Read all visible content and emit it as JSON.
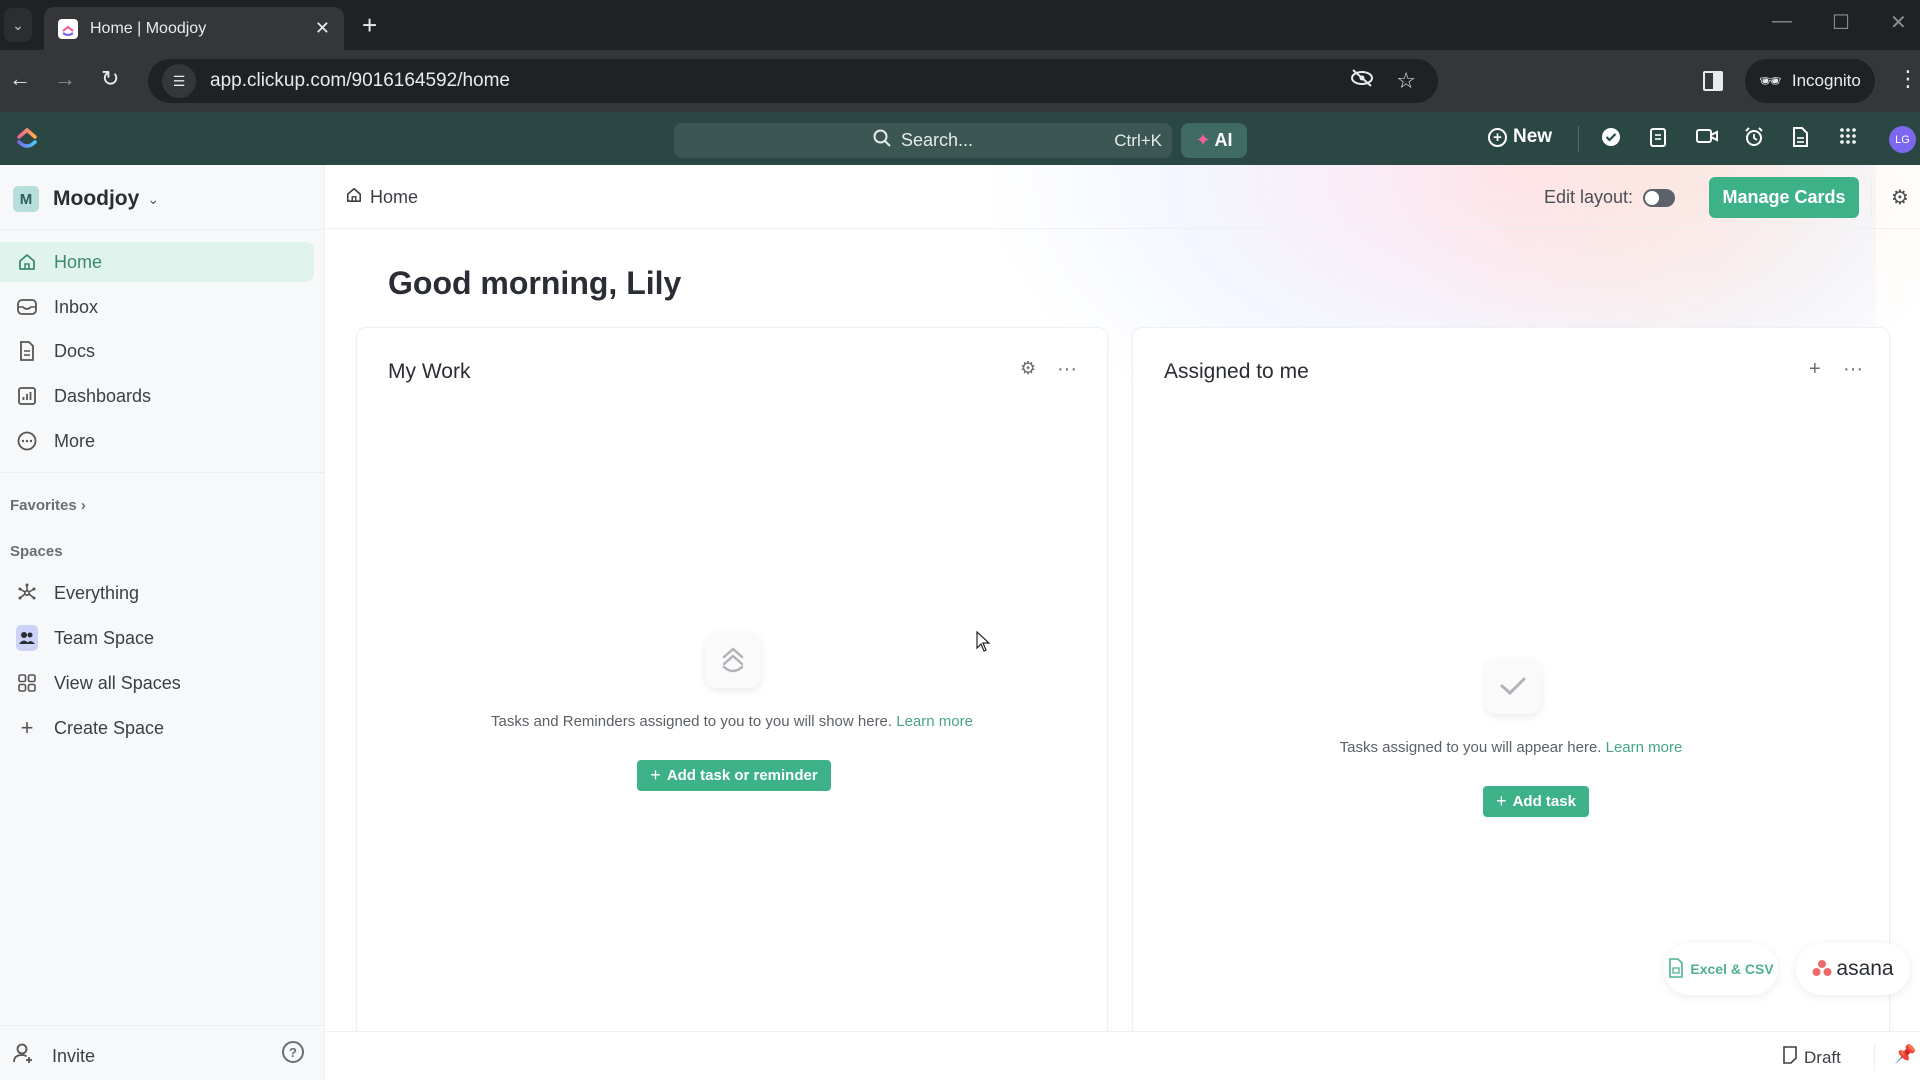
{
  "browser": {
    "tab_title": "Home | Moodjoy",
    "url": "app.clickup.com/9016164592/home",
    "incognito_label": "Incognito"
  },
  "appbar": {
    "search_placeholder": "Search...",
    "search_shortcut": "Ctrl+K",
    "ai_label": "AI",
    "new_label": "New",
    "avatar_initials": "LG",
    "icons": [
      "check-circle-icon",
      "notepad-icon",
      "video-icon",
      "alarm-clock-icon",
      "document-icon",
      "apps-grid-icon"
    ]
  },
  "sidebar": {
    "workspace_initial": "M",
    "workspace_name": "Moodjoy",
    "nav": [
      {
        "label": "Home",
        "icon": "home-icon",
        "active": true
      },
      {
        "label": "Inbox",
        "icon": "inbox-icon"
      },
      {
        "label": "Docs",
        "icon": "docs-icon"
      },
      {
        "label": "Dashboards",
        "icon": "dashboard-icon"
      },
      {
        "label": "More",
        "icon": "more-icon"
      }
    ],
    "favorites_label": "Favorites",
    "spaces_label": "Spaces",
    "spaces": [
      {
        "label": "Everything",
        "icon": "everything-icon"
      },
      {
        "label": "Team Space",
        "icon": "team-icon"
      },
      {
        "label": "View all Spaces",
        "icon": "grid-icon"
      },
      {
        "label": "Create Space",
        "icon": "plus-icon"
      }
    ],
    "invite_label": "Invite"
  },
  "main": {
    "breadcrumb": "Home",
    "edit_layout_label": "Edit layout:",
    "edit_layout_on": false,
    "manage_cards_label": "Manage Cards",
    "greeting": "Good morning, Lily",
    "cards": {
      "my_work": {
        "title": "My Work",
        "empty_text": "Tasks and Reminders assigned to you to you will show here.",
        "learn_more": "Learn more",
        "button": "Add task or reminder"
      },
      "assigned": {
        "title": "Assigned to me",
        "empty_text": "Tasks assigned to you will appear here.",
        "learn_more": "Learn more",
        "button": "Add task"
      }
    },
    "imports": {
      "excel_label": "Excel & CSV",
      "asana_label": "asana"
    },
    "draft_label": "Draft"
  },
  "colors": {
    "brand_green": "#3db288",
    "appbar_bg": "#2b4743",
    "active_nav_bg": "#e0f3ec"
  }
}
